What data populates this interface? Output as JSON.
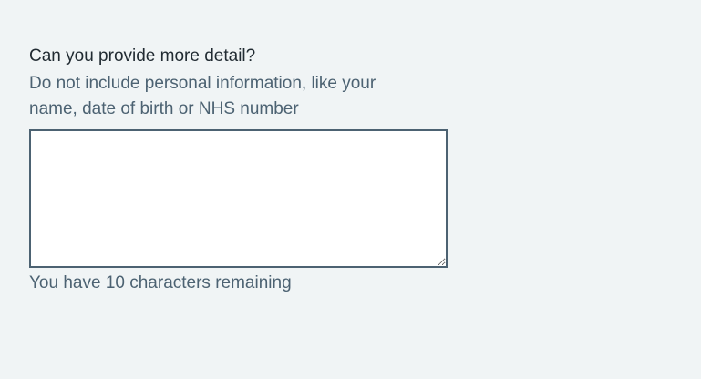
{
  "form": {
    "label": "Can you provide more detail?",
    "hint": "Do not include personal information, like your name, date of birth or NHS number",
    "textarea_value": "",
    "count_message": "You have 10 characters remaining"
  }
}
